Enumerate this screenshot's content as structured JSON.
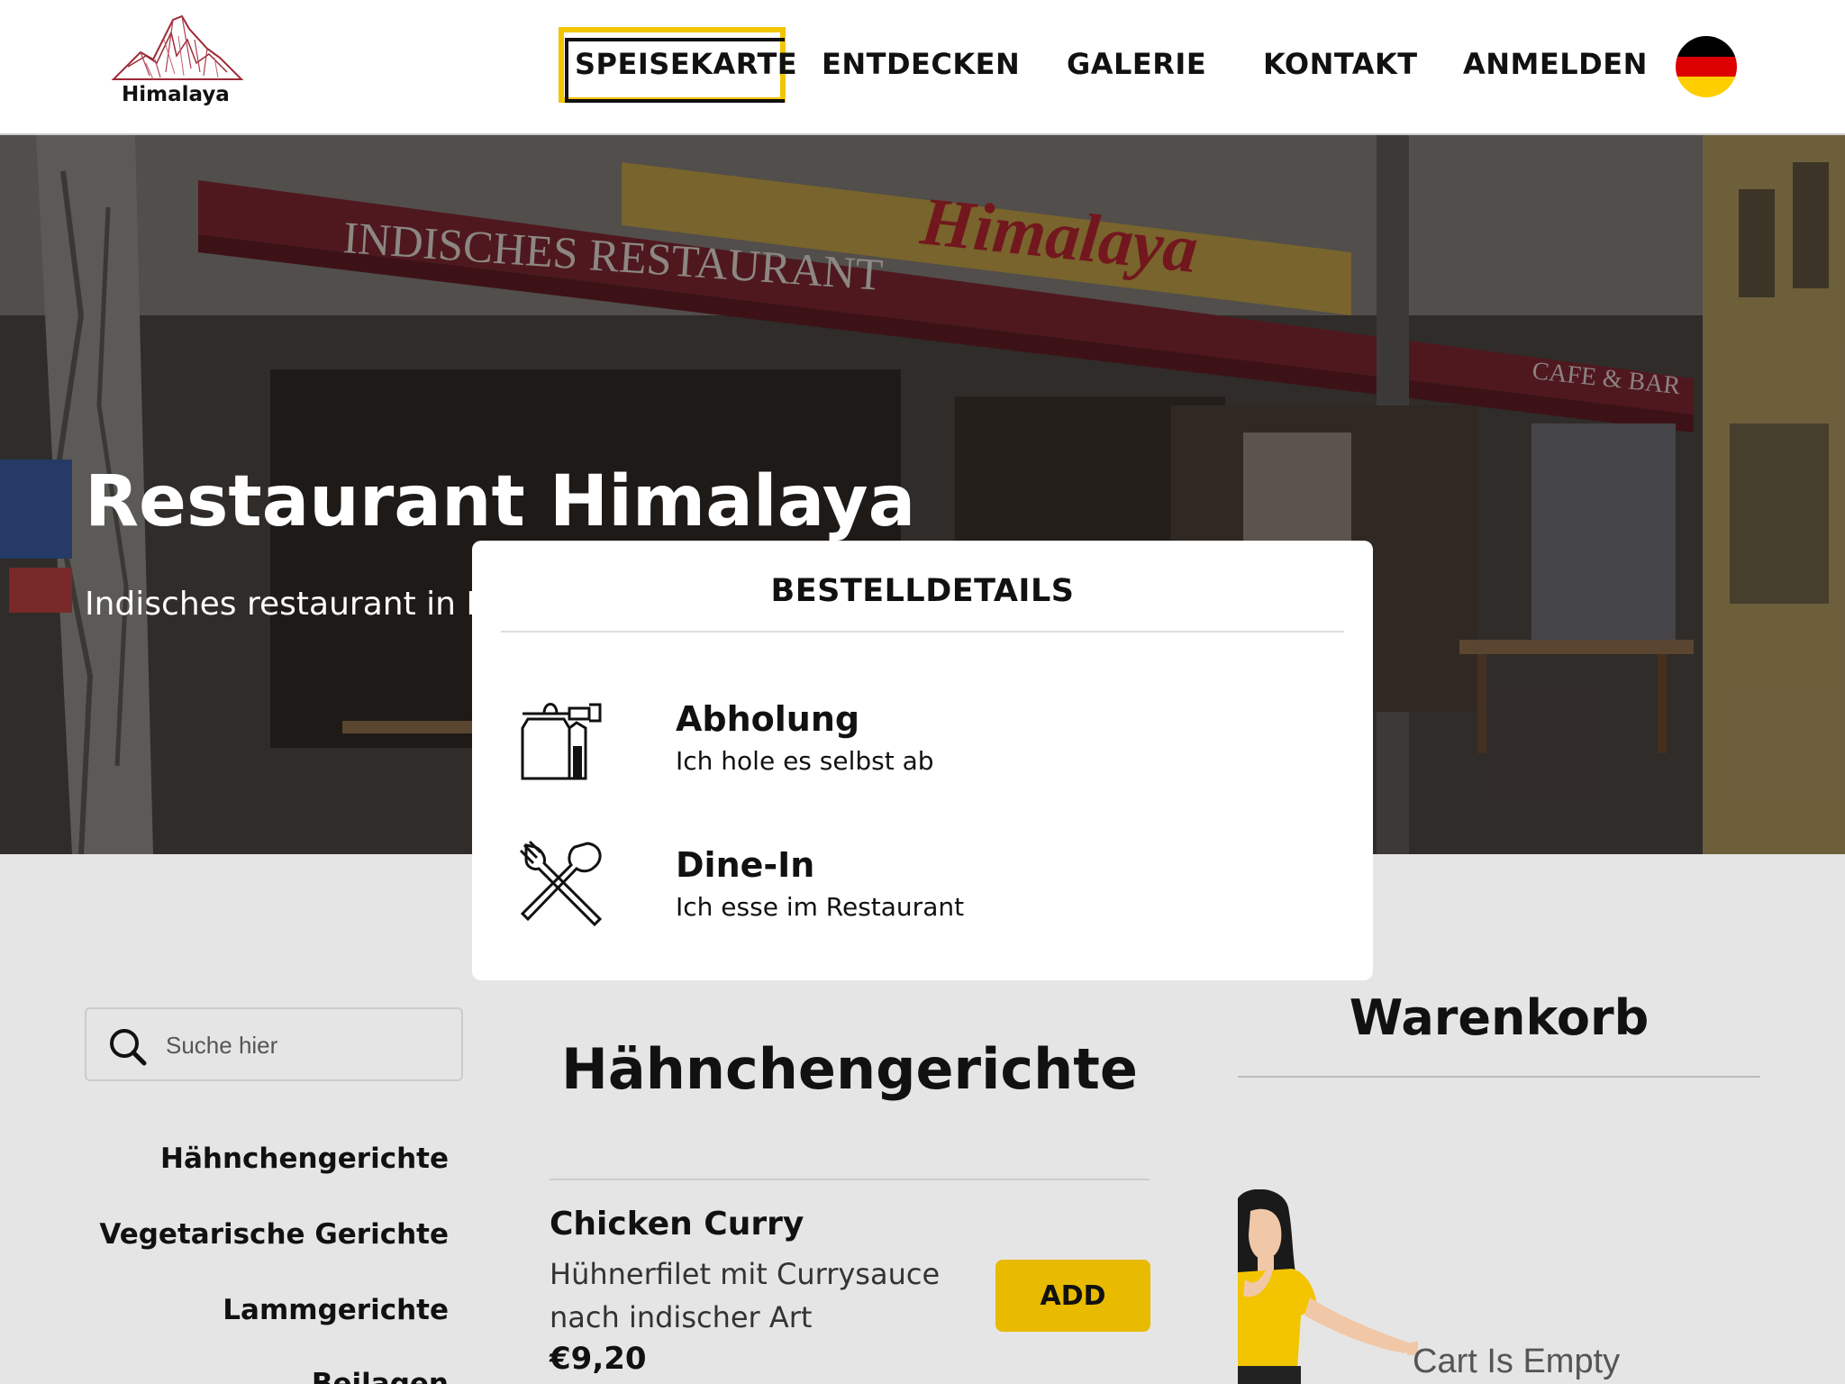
{
  "brand": {
    "logo_text": "Himalaya"
  },
  "nav": {
    "items": [
      {
        "label": "SPEISEKARTE",
        "active": true
      },
      {
        "label": "ENTDECKEN"
      },
      {
        "label": "GALERIE"
      },
      {
        "label": "KONTAKT"
      },
      {
        "label": "ANMELDEN"
      }
    ],
    "language": "de"
  },
  "hero": {
    "title": "Restaurant Himalaya",
    "subtitle": "Indisches restaurant in Berlin",
    "sign_left": "INDISCHES RESTAURANT",
    "sign_script": "Himalaya",
    "sign_right": "CAFE & BAR"
  },
  "order": {
    "title": "BESTELLDETAILS",
    "options": [
      {
        "title": "Abholung",
        "subtitle": "Ich hole es selbst ab",
        "icon": "takeaway-bag-icon"
      },
      {
        "title": "Dine-In",
        "subtitle": "Ich esse im Restaurant",
        "icon": "fork-spoon-icon"
      }
    ]
  },
  "search": {
    "placeholder": "Suche hier"
  },
  "categories": [
    "Hähnchengerichte",
    "Vegetarische Gerichte",
    "Lammgerichte",
    "Beilagen"
  ],
  "menu": {
    "section_title": "Hähnchengerichte",
    "items": [
      {
        "name": "Chicken Curry",
        "description": "Hühnerfilet mit Currysauce nach indischer Art",
        "price": "€9,20",
        "button": "ADD"
      }
    ]
  },
  "cart": {
    "title": "Warenkorb",
    "empty_text": "Cart Is Empty"
  },
  "colors": {
    "accent": "#e8ba00",
    "nav_highlight": "#f2c500",
    "background": "#e5e5e5"
  }
}
